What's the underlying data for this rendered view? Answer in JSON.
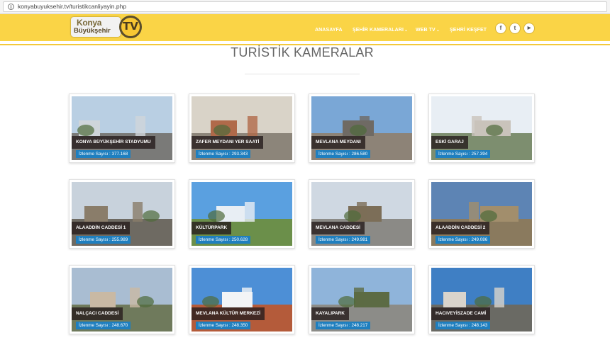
{
  "browser": {
    "url": "konyabuyuksehir.tv/turistikcanliyayin.php"
  },
  "header": {
    "logo_line1": "Konya",
    "logo_line2": "Büyükşehir",
    "logo_tv": "TV",
    "nav": [
      {
        "label": "ANASAYFA",
        "has_caret": false
      },
      {
        "label": "ŞEHİR KAMERALARI",
        "has_caret": true
      },
      {
        "label": "WEB TV",
        "has_caret": true
      },
      {
        "label": "ŞEHRİ KEŞFET",
        "has_caret": false
      }
    ],
    "caret": "⌄",
    "social": [
      {
        "icon": "facebook-icon",
        "glyph": "f"
      },
      {
        "icon": "twitter-icon",
        "glyph": "t"
      },
      {
        "icon": "youtube-icon",
        "glyph": "▶"
      }
    ]
  },
  "page_title": "TURİSTİK KAMERALAR",
  "views_prefix": "İzlenme Sayısı : ",
  "cameras": [
    {
      "name": "KONYA BÜYÜKŞEHİR STADYUMU",
      "views": "377.168"
    },
    {
      "name": "ZAFER MEYDANI YER SAATİ",
      "views": "293.343"
    },
    {
      "name": "MEVLANA MEYDANI",
      "views": "286.580"
    },
    {
      "name": "ESKİ GARAJ",
      "views": "257.394"
    },
    {
      "name": "ALAADDİN CADDESİ 1",
      "views": "255.989"
    },
    {
      "name": "KÜLTÜRPARK",
      "views": "250.628"
    },
    {
      "name": "MEVLANA CADDESİ",
      "views": "249.981"
    },
    {
      "name": "ALAADDİN CADDESİ 2",
      "views": "249.086"
    },
    {
      "name": "NALÇACI CADDESİ",
      "views": "248.670"
    },
    {
      "name": "MEVLANA KÜLTÜR MERKEZİ",
      "views": "248.350"
    },
    {
      "name": "KAYALIPARK",
      "views": "248.217"
    },
    {
      "name": "HACIVEYİSZADE CAMİ",
      "views": "248.143"
    }
  ],
  "colors": {
    "header_yellow": "#fad446",
    "views_badge": "#1f7fbf",
    "caption_bg": "#2a1e1e"
  }
}
